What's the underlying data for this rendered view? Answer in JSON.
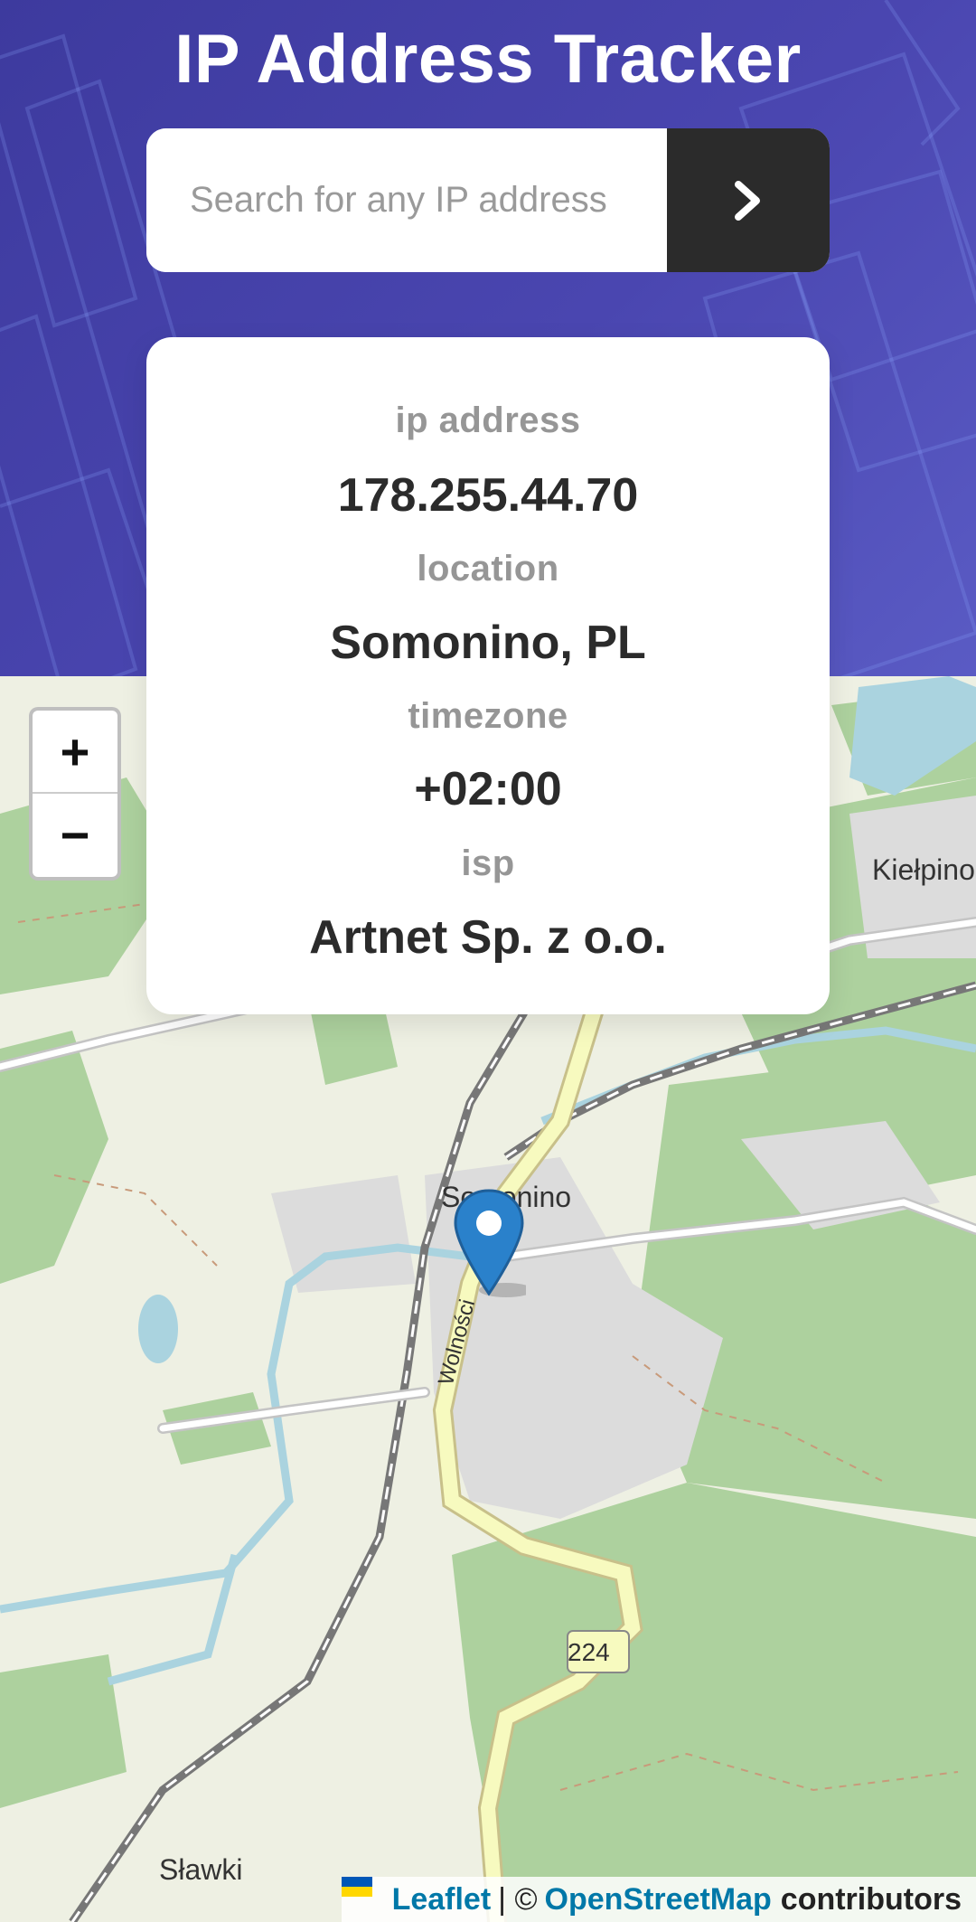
{
  "header": {
    "title": "IP Address Tracker",
    "search_placeholder": "Search for any IP address",
    "submit_icon": "chevron-right-icon"
  },
  "info": {
    "ip_label": "ip address",
    "ip_value": "178.255.44.70",
    "location_label": "location",
    "location_value": "Somonino, PL",
    "timezone_label": "timezone",
    "timezone_value": "+02:00",
    "isp_label": "isp",
    "isp_value": "Artnet Sp. z o.o."
  },
  "map": {
    "zoom_in": "+",
    "zoom_out": "−",
    "place_labels": [
      "Somonino",
      "Kiełpino",
      "Sławki"
    ],
    "road_number": "224",
    "street_label": "Wolności",
    "attribution_leaflet": "Leaflet",
    "attribution_separator": "| ©",
    "attribution_osm": "OpenStreetMap",
    "attribution_suffix": "contributors"
  },
  "colors": {
    "header_bg": "#4a46b0",
    "button_bg": "#2b2b2b",
    "label_gray": "#969696",
    "value_dark": "#2b2b2b",
    "marker_blue": "#2a81cb",
    "link_blue": "#0078a8"
  }
}
